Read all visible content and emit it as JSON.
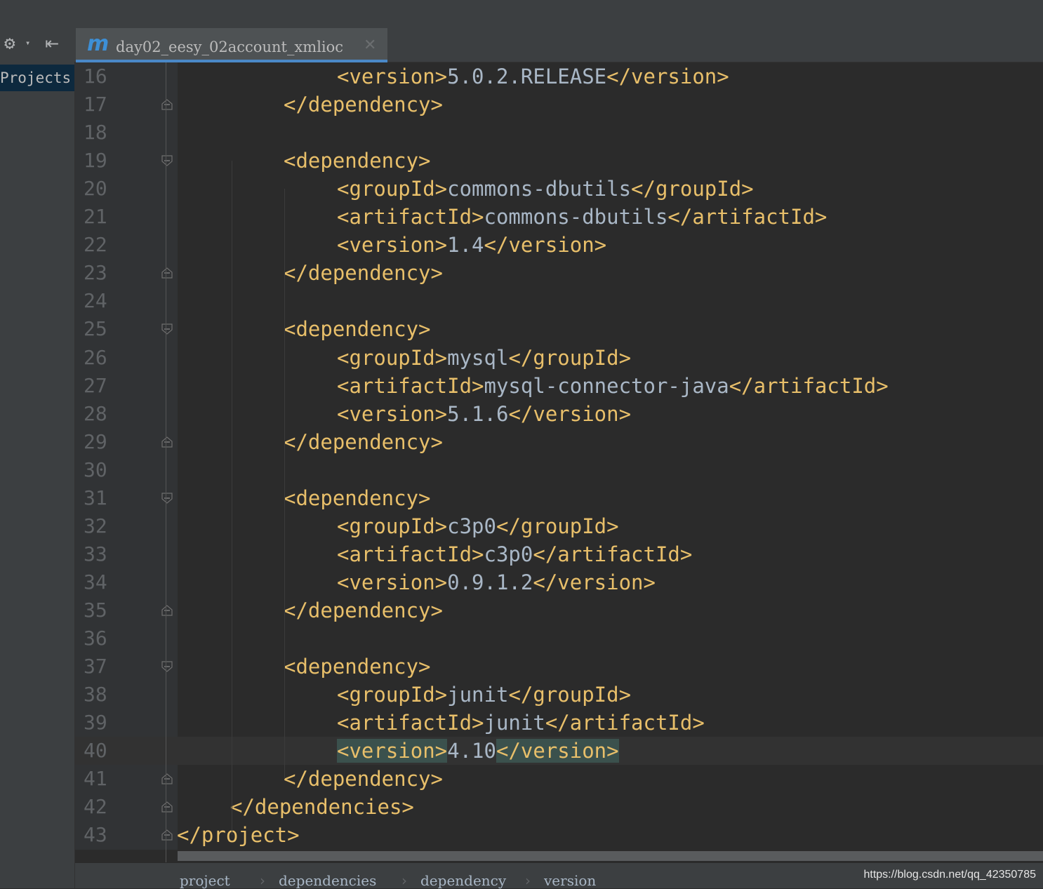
{
  "toolbar": {
    "settings_icon": "gear-icon",
    "collapse_icon": "collapse-left-icon"
  },
  "sidebar": {
    "projects_label": "Projects"
  },
  "editor_tab": {
    "icon": "maven-m-icon",
    "title": "day02_eesy_02account_xmlioc",
    "close_icon": "close-icon"
  },
  "lines": [
    {
      "num": "16",
      "indent": 3,
      "parts": [
        [
          "tag",
          "<version>"
        ],
        [
          "txt",
          "5.0.2.RELEASE"
        ],
        [
          "tag",
          "</version>"
        ]
      ]
    },
    {
      "num": "17",
      "indent": 2,
      "fold": "end",
      "parts": [
        [
          "tag",
          "</dependency>"
        ]
      ]
    },
    {
      "num": "18",
      "indent": 0,
      "parts": []
    },
    {
      "num": "19",
      "indent": 2,
      "fold": "start",
      "parts": [
        [
          "tag",
          "<dependency>"
        ]
      ]
    },
    {
      "num": "20",
      "indent": 3,
      "parts": [
        [
          "tag",
          "<groupId>"
        ],
        [
          "txt",
          "commons-dbutils"
        ],
        [
          "tag",
          "</groupId>"
        ]
      ]
    },
    {
      "num": "21",
      "indent": 3,
      "parts": [
        [
          "tag",
          "<artifactId>"
        ],
        [
          "txt",
          "commons-dbutils"
        ],
        [
          "tag",
          "</artifactId>"
        ]
      ]
    },
    {
      "num": "22",
      "indent": 3,
      "parts": [
        [
          "tag",
          "<version>"
        ],
        [
          "txt",
          "1.4"
        ],
        [
          "tag",
          "</version>"
        ]
      ]
    },
    {
      "num": "23",
      "indent": 2,
      "fold": "end",
      "parts": [
        [
          "tag",
          "</dependency>"
        ]
      ]
    },
    {
      "num": "24",
      "indent": 0,
      "parts": []
    },
    {
      "num": "25",
      "indent": 2,
      "fold": "start",
      "parts": [
        [
          "tag",
          "<dependency>"
        ]
      ]
    },
    {
      "num": "26",
      "indent": 3,
      "parts": [
        [
          "tag",
          "<groupId>"
        ],
        [
          "txt",
          "mysql"
        ],
        [
          "tag",
          "</groupId>"
        ]
      ]
    },
    {
      "num": "27",
      "indent": 3,
      "parts": [
        [
          "tag",
          "<artifactId>"
        ],
        [
          "txt",
          "mysql-connector-java"
        ],
        [
          "tag",
          "</artifactId>"
        ]
      ]
    },
    {
      "num": "28",
      "indent": 3,
      "parts": [
        [
          "tag",
          "<version>"
        ],
        [
          "txt",
          "5.1.6"
        ],
        [
          "tag",
          "</version>"
        ]
      ]
    },
    {
      "num": "29",
      "indent": 2,
      "fold": "end",
      "parts": [
        [
          "tag",
          "</dependency>"
        ]
      ]
    },
    {
      "num": "30",
      "indent": 0,
      "parts": []
    },
    {
      "num": "31",
      "indent": 2,
      "fold": "start",
      "parts": [
        [
          "tag",
          "<dependency>"
        ]
      ]
    },
    {
      "num": "32",
      "indent": 3,
      "parts": [
        [
          "tag",
          "<groupId>"
        ],
        [
          "txt",
          "c3p0"
        ],
        [
          "tag",
          "</groupId>"
        ]
      ]
    },
    {
      "num": "33",
      "indent": 3,
      "parts": [
        [
          "tag",
          "<artifactId>"
        ],
        [
          "txt",
          "c3p0"
        ],
        [
          "tag",
          "</artifactId>"
        ]
      ]
    },
    {
      "num": "34",
      "indent": 3,
      "parts": [
        [
          "tag",
          "<version>"
        ],
        [
          "txt",
          "0.9.1.2"
        ],
        [
          "tag",
          "</version>"
        ]
      ]
    },
    {
      "num": "35",
      "indent": 2,
      "fold": "end",
      "parts": [
        [
          "tag",
          "</dependency>"
        ]
      ]
    },
    {
      "num": "36",
      "indent": 0,
      "parts": []
    },
    {
      "num": "37",
      "indent": 2,
      "fold": "start",
      "parts": [
        [
          "tag",
          "<dependency>"
        ]
      ]
    },
    {
      "num": "38",
      "indent": 3,
      "parts": [
        [
          "tag",
          "<groupId>"
        ],
        [
          "txt",
          "junit"
        ],
        [
          "tag",
          "</groupId>"
        ]
      ]
    },
    {
      "num": "39",
      "indent": 3,
      "parts": [
        [
          "tag",
          "<artifactId>"
        ],
        [
          "txt",
          "junit"
        ],
        [
          "tag",
          "</artifactId>"
        ]
      ]
    },
    {
      "num": "40",
      "indent": 3,
      "current": true,
      "parts": [
        [
          "tag hl",
          "<version>"
        ],
        [
          "txt",
          "4.10"
        ],
        [
          "tag hl",
          "</version>"
        ]
      ]
    },
    {
      "num": "41",
      "indent": 2,
      "fold": "end",
      "parts": [
        [
          "tag",
          "</dependency>"
        ]
      ]
    },
    {
      "num": "42",
      "indent": 1,
      "fold": "end",
      "parts": [
        [
          "tag",
          "</dependencies>"
        ]
      ]
    },
    {
      "num": "43",
      "indent": 0,
      "fold": "end",
      "parts": [
        [
          "tag",
          "</project>"
        ]
      ]
    }
  ],
  "breadcrumbs": [
    "project",
    "dependencies",
    "dependency",
    "version"
  ],
  "watermark": "https://blog.csdn.net/qq_42350785"
}
